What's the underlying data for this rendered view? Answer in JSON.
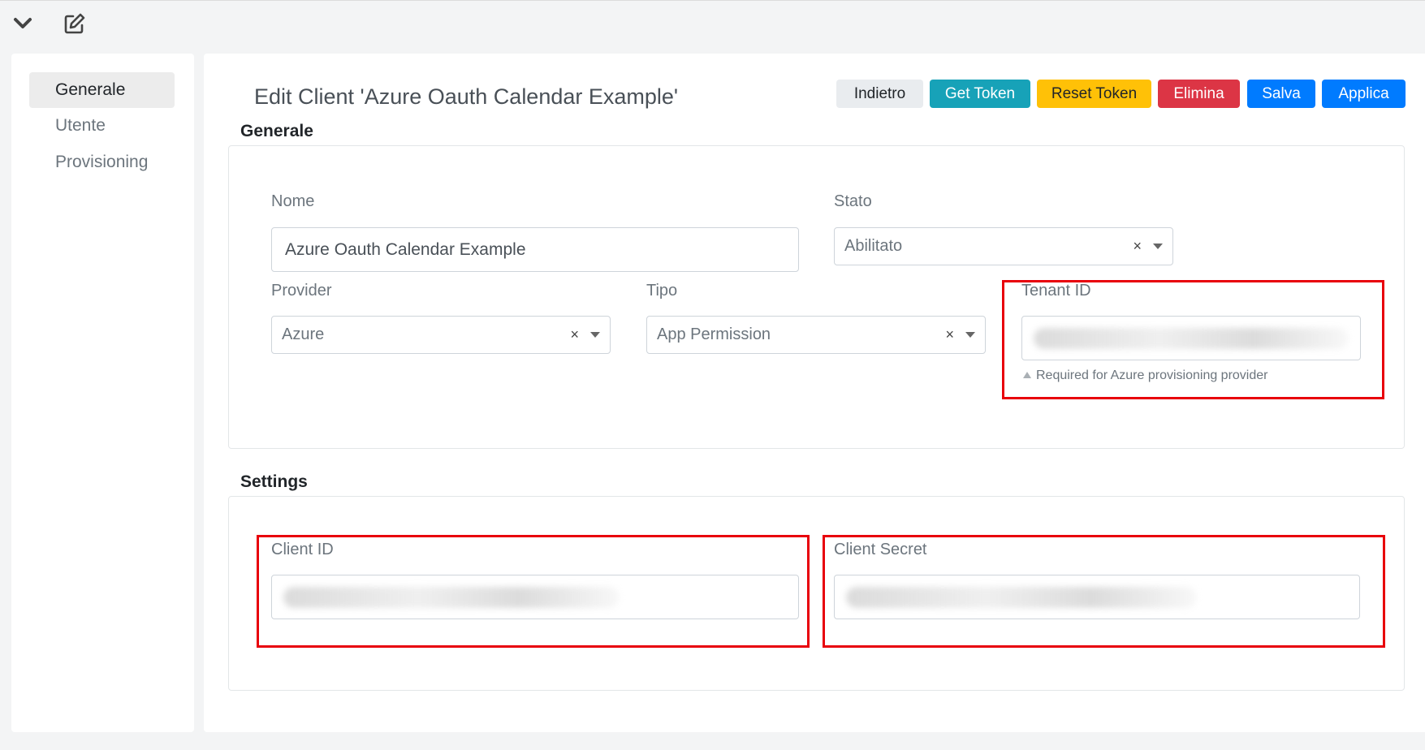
{
  "toolbar": {
    "collapse_icon": "chevron-down-icon",
    "edit_icon": "edit-icon"
  },
  "sidebar": {
    "items": [
      {
        "label": "Generale",
        "active": true
      },
      {
        "label": "Utente",
        "active": false
      },
      {
        "label": "Provisioning",
        "active": false
      }
    ]
  },
  "header": {
    "title": "Edit Client 'Azure Oauth Calendar Example'"
  },
  "actions": {
    "back": {
      "label": "Indietro",
      "color": "#e9ecef"
    },
    "get_token": {
      "label": "Get Token",
      "color": "#17a2b8"
    },
    "reset_token": {
      "label": "Reset Token",
      "color": "#ffc107"
    },
    "delete": {
      "label": "Elimina",
      "color": "#dc3545"
    },
    "save": {
      "label": "Salva",
      "color": "#007bff"
    },
    "apply": {
      "label": "Applica",
      "color": "#007bff"
    }
  },
  "general": {
    "title": "Generale",
    "name": {
      "label": "Nome",
      "value": "Azure Oauth Calendar Example"
    },
    "status": {
      "label": "Stato",
      "value": "Abilitato",
      "clear": "×"
    },
    "provider": {
      "label": "Provider",
      "value": "Azure",
      "clear": "×"
    },
    "type": {
      "label": "Tipo",
      "value": "App Permission",
      "clear": "×"
    },
    "tenant_id": {
      "label": "Tenant ID",
      "help": "Required for Azure provisioning provider"
    }
  },
  "settings": {
    "title": "Settings",
    "client_id": {
      "label": "Client ID"
    },
    "client_secret": {
      "label": "Client Secret"
    }
  },
  "colors": {
    "highlight": "#e8000b"
  }
}
